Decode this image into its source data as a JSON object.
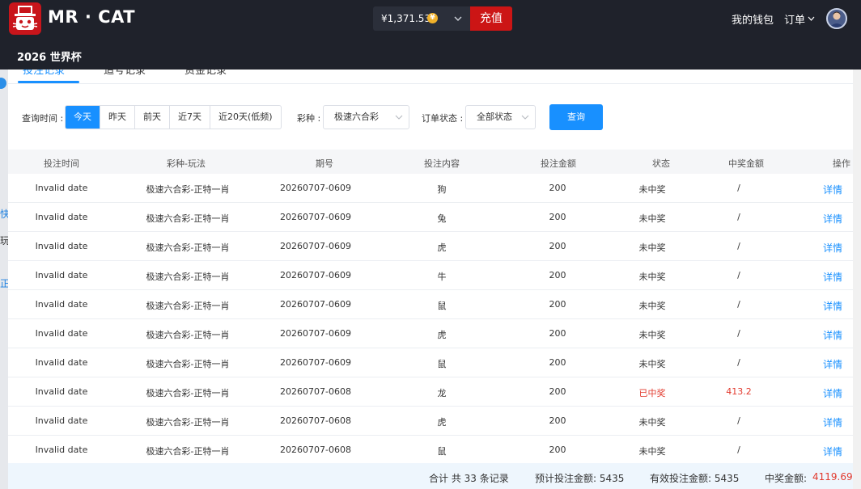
{
  "header": {
    "brand": "MR · CAT",
    "balance": "¥1,371.53",
    "coin_symbol": "¥",
    "recharge_label": "充值",
    "wallet_label": "我的钱包",
    "orders_label": "订单",
    "subnav_item": "2026 世界杯"
  },
  "tabs": [
    {
      "label": "投注记录",
      "active": true
    },
    {
      "label": "追号记录",
      "active": false
    },
    {
      "label": "资金记录",
      "active": false
    }
  ],
  "left_strip": {
    "items": [
      "快",
      "玩",
      "正"
    ]
  },
  "filters": {
    "time_label": "查询时间 :",
    "time_options": [
      "今天",
      "昨天",
      "前天",
      "近7天",
      "近20天(低频)"
    ],
    "time_selected": "今天",
    "lottery_label": "彩种 :",
    "lottery_value": "极速六合彩",
    "status_label": "订单状态 :",
    "status_value": "全部状态",
    "query_label": "查询"
  },
  "table": {
    "columns": [
      "投注时间",
      "彩种-玩法",
      "期号",
      "投注内容",
      "投注金额",
      "状态",
      "中奖金额",
      "操作"
    ],
    "rows": [
      [
        "Invalid date",
        "极速六合彩-正特一肖",
        "20260707-0609",
        "狗",
        "200",
        "未中奖",
        "/",
        "详情"
      ],
      [
        "Invalid date",
        "极速六合彩-正特一肖",
        "20260707-0609",
        "兔",
        "200",
        "未中奖",
        "/",
        "详情"
      ],
      [
        "Invalid date",
        "极速六合彩-正特一肖",
        "20260707-0609",
        "虎",
        "200",
        "未中奖",
        "/",
        "详情"
      ],
      [
        "Invalid date",
        "极速六合彩-正特一肖",
        "20260707-0609",
        "牛",
        "200",
        "未中奖",
        "/",
        "详情"
      ],
      [
        "Invalid date",
        "极速六合彩-正特一肖",
        "20260707-0609",
        "鼠",
        "200",
        "未中奖",
        "/",
        "详情"
      ],
      [
        "Invalid date",
        "极速六合彩-正特一肖",
        "20260707-0609",
        "虎",
        "200",
        "未中奖",
        "/",
        "详情"
      ],
      [
        "Invalid date",
        "极速六合彩-正特一肖",
        "20260707-0609",
        "鼠",
        "200",
        "未中奖",
        "/",
        "详情"
      ],
      [
        "Invalid date",
        "极速六合彩-正特一肖",
        "20260707-0608",
        "龙",
        "200",
        "已中奖",
        "413.2",
        "详情"
      ],
      [
        "Invalid date",
        "极速六合彩-正特一肖",
        "20260707-0608",
        "虎",
        "200",
        "未中奖",
        "/",
        "详情"
      ],
      [
        "Invalid date",
        "极速六合彩-正特一肖",
        "20260707-0608",
        "鼠",
        "200",
        "未中奖",
        "/",
        "详情"
      ]
    ],
    "won_status": "已中奖"
  },
  "summary": {
    "total_records": "合计 共 33 条记录",
    "expected_bet": "预计投注金额: 5435",
    "valid_bet": "有效投注金额: 5435",
    "win_label": "中奖金额:",
    "win_amount": "4119.692"
  },
  "colors": {
    "navbar": "#1f222b",
    "accent": "#1890ff",
    "recharge": "#cc1515",
    "won": "#e23a2e"
  }
}
